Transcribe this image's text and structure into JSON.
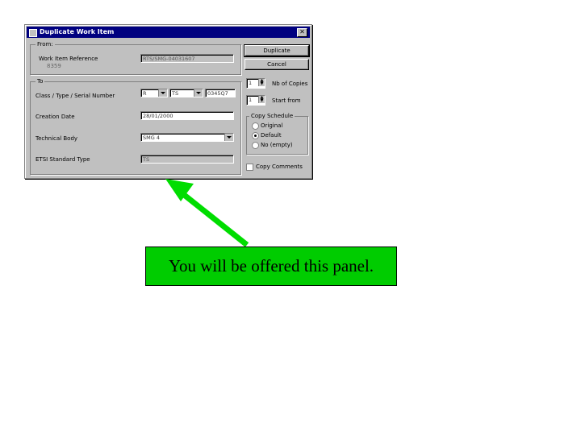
{
  "dialog": {
    "title": "Duplicate Work Item",
    "close_label": "✕",
    "from_group": {
      "label": "From:",
      "work_item_reference_label": "Work Item Reference",
      "work_item_reference_value": "RTS/SMG-04031607",
      "code": "8359"
    },
    "to_group": {
      "label": "To",
      "class_type_serial_label": "Class / Type / Serial Number",
      "class_value": "R",
      "type_value": "TS",
      "serial_value": "0345Q7",
      "creation_date_label": "Creation Date",
      "creation_date_value": "28/01/2000",
      "technical_body_label": "Technical Body",
      "technical_body_value": "SMG 4",
      "etsi_standard_type_label": "ETSI Standard Type",
      "etsi_standard_type_value": "TS"
    },
    "buttons": {
      "duplicate": "Duplicate",
      "cancel": "Cancel"
    },
    "nb_copies_value": "1",
    "nb_copies_label": "Nb of Copies",
    "start_from_value": "1",
    "start_from_label": "Start from",
    "copy_schedule": {
      "label": "Copy Schedule",
      "options": [
        "Original",
        "Default",
        "No (empty)"
      ],
      "selected": "Default"
    },
    "copy_comments_label": "Copy Comments"
  },
  "callout": {
    "text": "You will be offered this panel."
  },
  "colors": {
    "arrow": "#00dd00",
    "callout_bg": "#00cc00",
    "titlebar": "#000080"
  }
}
